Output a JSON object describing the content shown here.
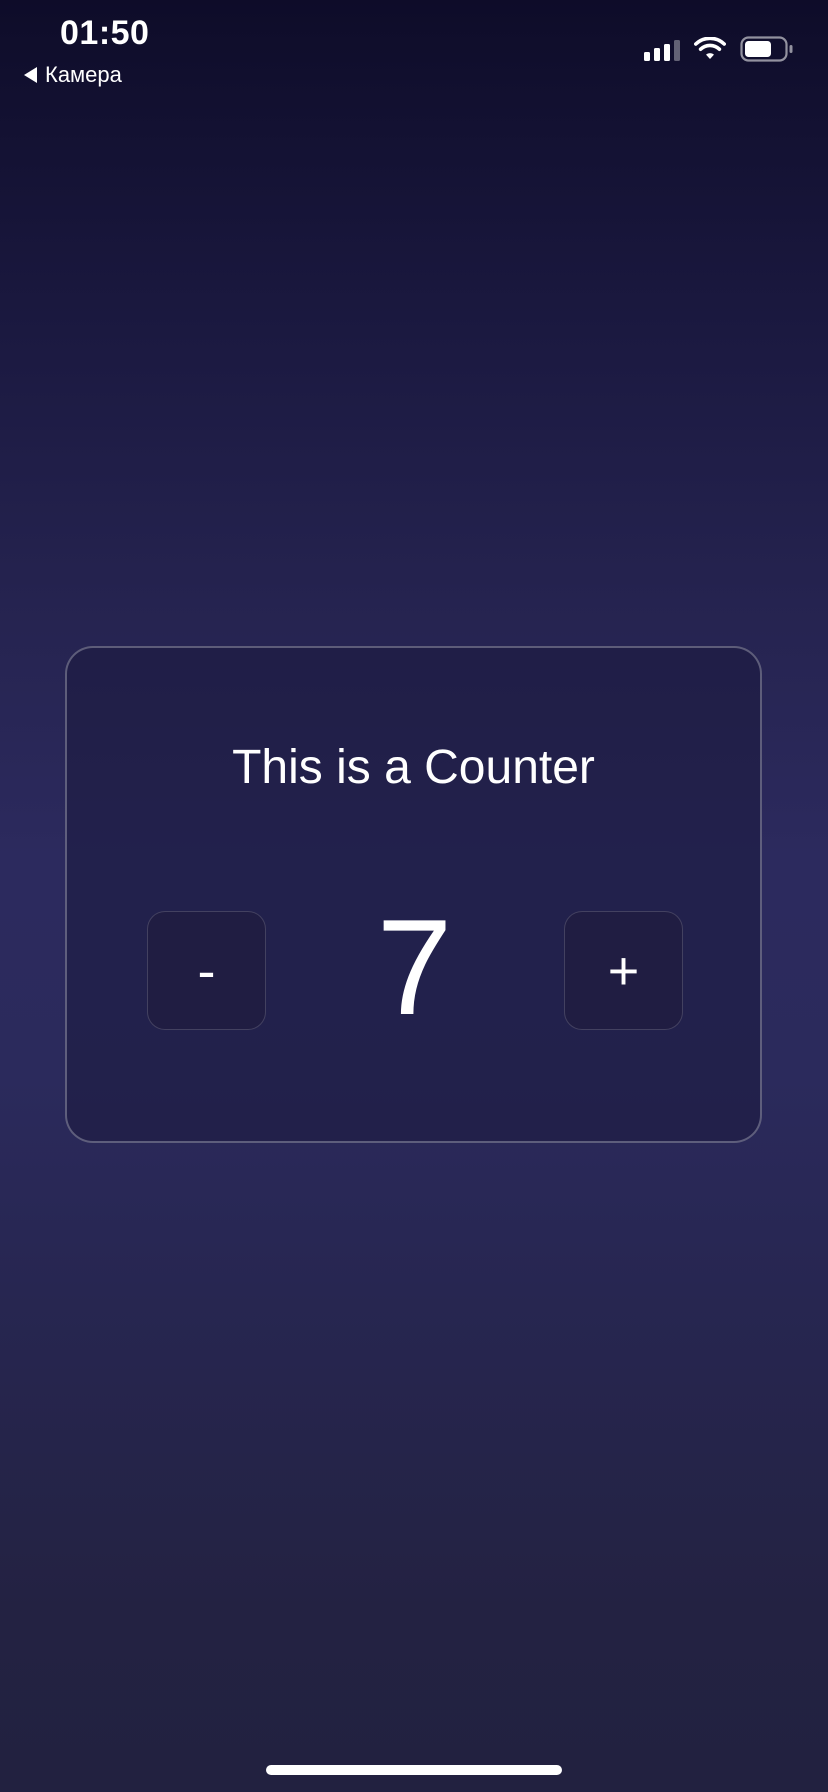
{
  "status_bar": {
    "time": "01:50",
    "back_label": "Камера",
    "signal_icon": "cellular-signal-icon",
    "wifi_icon": "wifi-icon",
    "battery_icon": "battery-icon"
  },
  "card": {
    "title": "This is a Counter",
    "decrement_label": "-",
    "increment_label": "+",
    "count": "7"
  },
  "colors": {
    "background_top": "#0e0c29",
    "background_mid": "#2c2a5e",
    "background_bottom": "#222140",
    "button_fill": "#201d42",
    "text": "#ffffff"
  }
}
